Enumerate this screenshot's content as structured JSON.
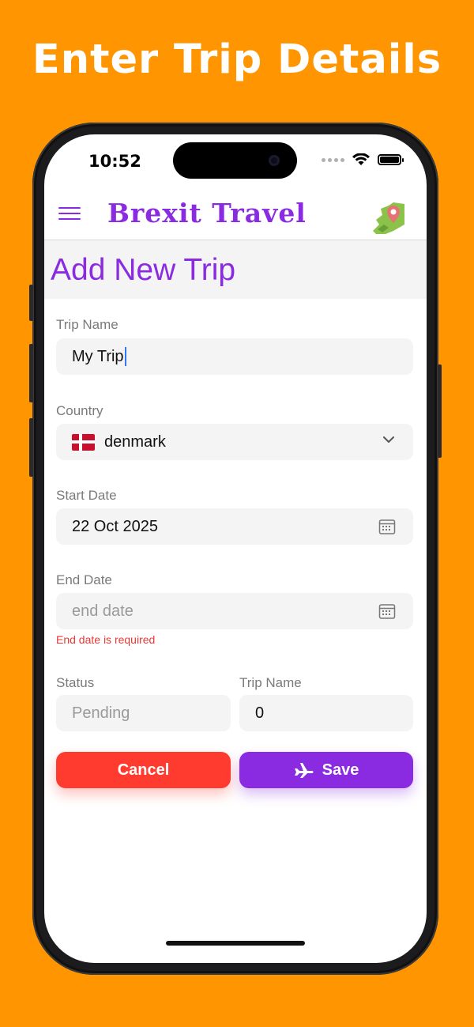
{
  "headline": "Enter Trip Details",
  "status_bar": {
    "time": "10:52"
  },
  "nav": {
    "brand": "Brexit Travel"
  },
  "page": {
    "title": "Add New Trip"
  },
  "form": {
    "trip_name": {
      "label": "Trip Name",
      "value": "My Trip"
    },
    "country": {
      "label": "Country",
      "value": "denmark",
      "flag": "denmark-flag"
    },
    "start_date": {
      "label": "Start Date",
      "value": "22 Oct 2025"
    },
    "end_date": {
      "label": "End Date",
      "placeholder": "end date",
      "error": "End date is required"
    },
    "status": {
      "label": "Status",
      "placeholder": "Pending"
    },
    "trip_count": {
      "label": "Trip Name",
      "value": "0"
    }
  },
  "buttons": {
    "cancel": "Cancel",
    "save": "Save"
  },
  "colors": {
    "accent": "#8A2BE2",
    "danger": "#FF3B30",
    "background": "#FF9500"
  }
}
